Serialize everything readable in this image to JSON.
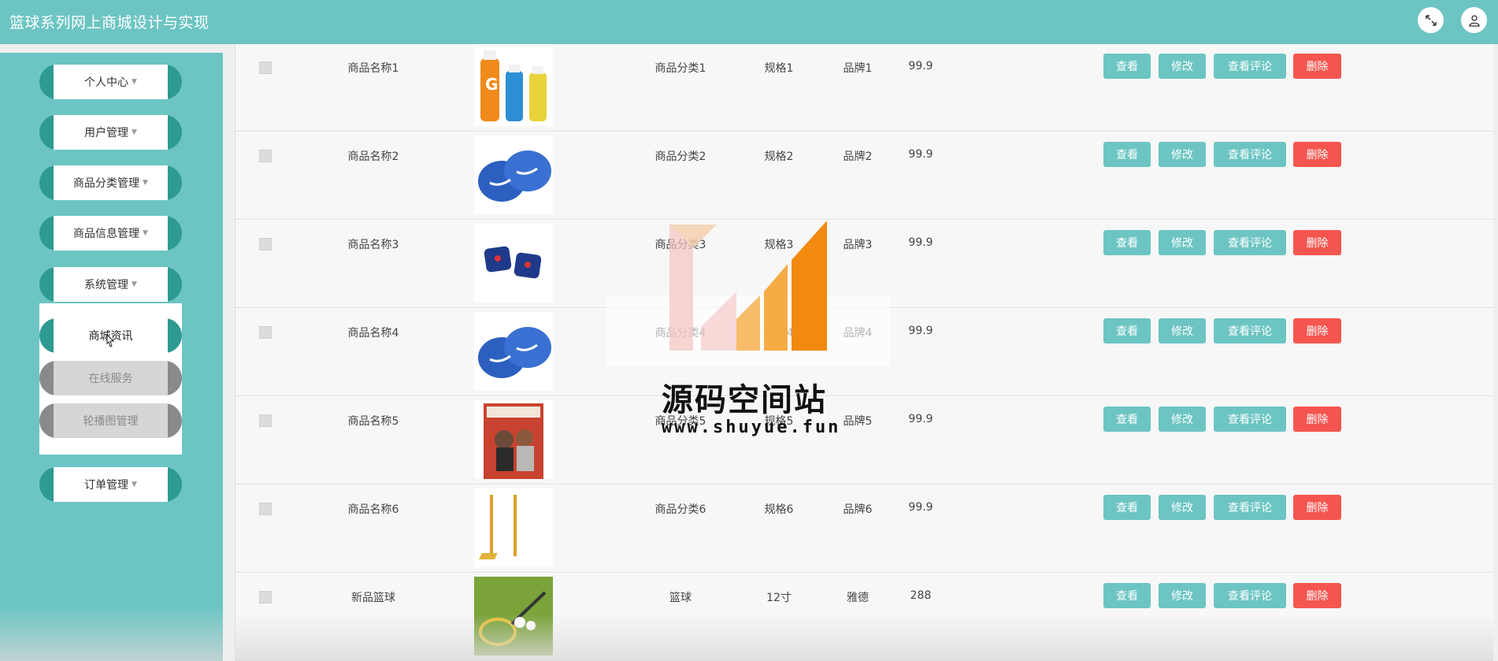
{
  "header": {
    "title": "篮球系列网上商城设计与实现",
    "fullscreen_icon": "expand-icon",
    "user_icon": "user-icon"
  },
  "sidebar": {
    "items": [
      {
        "label": "个人中心"
      },
      {
        "label": "用户管理"
      },
      {
        "label": "商品分类管理"
      },
      {
        "label": "商品信息管理"
      },
      {
        "label": "系统管理"
      },
      {
        "label": "订单管理"
      }
    ],
    "submenu": [
      {
        "label": "商城资讯",
        "active": true
      },
      {
        "label": "在线服务",
        "active": false
      },
      {
        "label": "轮播图管理",
        "active": false
      }
    ]
  },
  "table": {
    "actions": {
      "view": "查看",
      "edit": "修改",
      "comments": "查看评论",
      "delete": "删除"
    },
    "rows": [
      {
        "name": "商品名称1",
        "image": "sports-drink-bottles",
        "category": "商品分类1",
        "spec": "规格1",
        "brand": "品牌1",
        "price": "99.9"
      },
      {
        "name": "商品名称2",
        "image": "blue-wristbands",
        "category": "商品分类2",
        "spec": "规格2",
        "brand": "品牌2",
        "price": "99.9"
      },
      {
        "name": "商品名称3",
        "image": "navy-wristbands",
        "category": "商品分类3",
        "spec": "规格3",
        "brand": "品牌3",
        "price": "99.9"
      },
      {
        "name": "商品名称4",
        "image": "blue-wristbands",
        "category": "商品分类4",
        "spec": "规格4",
        "brand": "品牌4",
        "price": "99.9"
      },
      {
        "name": "商品名称5",
        "image": "basketball-magazine",
        "category": "商品分类5",
        "spec": "规格5",
        "brand": "品牌5",
        "price": "99.9"
      },
      {
        "name": "商品名称6",
        "image": "badminton-net-stand",
        "category": "商品分类6",
        "spec": "规格6",
        "brand": "品牌6",
        "price": "99.9"
      },
      {
        "name": "新品篮球",
        "image": "badminton-racket-shuttle",
        "category": "篮球",
        "spec": "12寸",
        "brand": "雅德",
        "price": "288"
      }
    ]
  },
  "watermark": {
    "text": "源码空间站",
    "url": "www.shuyue.fun"
  },
  "colors": {
    "primary": "#6cc5c3",
    "dark_teal": "#2e9a92",
    "danger": "#f4564f"
  }
}
